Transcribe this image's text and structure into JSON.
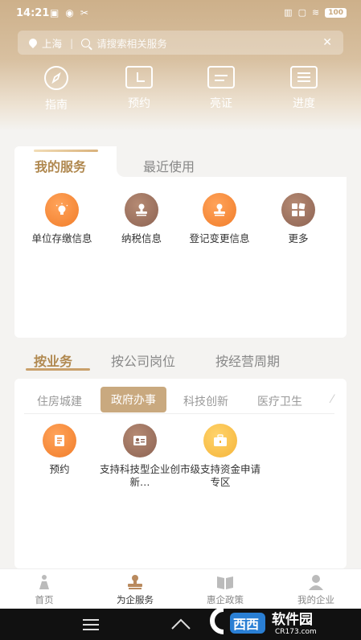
{
  "status": {
    "time": "14:21",
    "battery": "100"
  },
  "search": {
    "city": "上海",
    "placeholder": "请搜索相关服务"
  },
  "quick_actions": [
    {
      "label": "指南",
      "icon": "compass-icon"
    },
    {
      "label": "预约",
      "icon": "calendar-icon"
    },
    {
      "label": "亮证",
      "icon": "id-card-icon"
    },
    {
      "label": "进度",
      "icon": "list-icon"
    }
  ],
  "service_tabs": {
    "active": "我的服务",
    "inactive": "最近使用"
  },
  "services": [
    {
      "label": "单位存缴信息",
      "icon": "lightbulb-icon",
      "color": "#f5883a"
    },
    {
      "label": "纳税信息",
      "icon": "stamp-icon",
      "color": "#9c7160"
    },
    {
      "label": "登记变更信息",
      "icon": "stamp-icon",
      "color": "#f5883a"
    },
    {
      "label": "更多",
      "icon": "grid-icon",
      "color": "#9c7160"
    }
  ],
  "category_tabs": [
    "按业务",
    "按公司岗位",
    "按经营周期"
  ],
  "sub_tabs": [
    "住房城建",
    "政府办事",
    "科技创新",
    "医疗卫生"
  ],
  "active_sub_tab": "政府办事",
  "items": [
    {
      "label": "预约",
      "icon": "document-icon",
      "color": "#f5883a"
    },
    {
      "label": "支持科技型企业创新…",
      "icon": "id-card-icon",
      "color": "#9c7160"
    },
    {
      "label": "市级支持资金申请专区",
      "icon": "briefcase-icon",
      "color": "#f5b53b"
    }
  ],
  "bottom_nav": [
    {
      "label": "首页",
      "icon": "home-icon",
      "active": false
    },
    {
      "label": "为企服务",
      "icon": "stamp-icon",
      "active": true
    },
    {
      "label": "惠企政策",
      "icon": "book-icon",
      "active": false
    },
    {
      "label": "我的企业",
      "icon": "person-icon",
      "active": false
    }
  ],
  "watermark": {
    "brand": "软件园",
    "site": "CR173.com"
  }
}
